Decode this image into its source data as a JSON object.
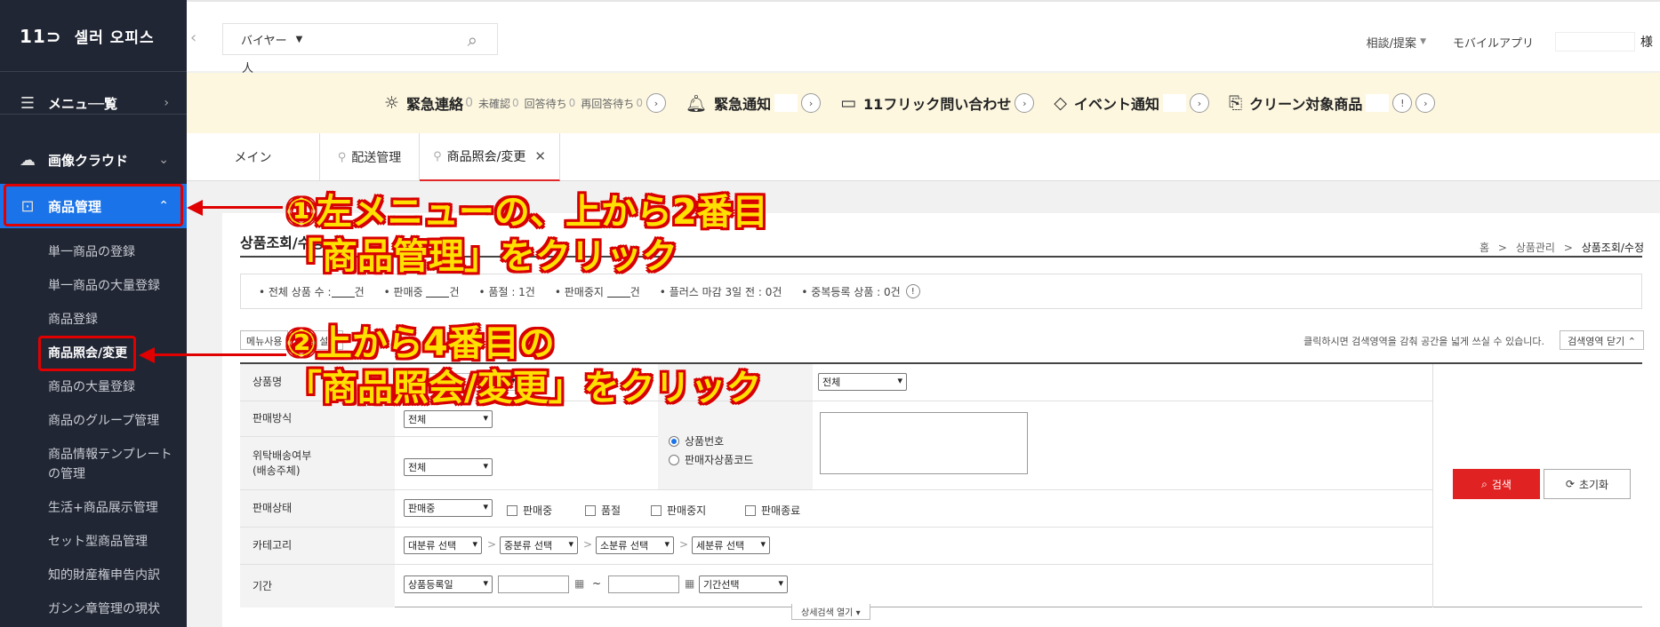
{
  "sidebar": {
    "logo_mark": "11⊃",
    "logo_text": "셀러 오피스",
    "menu_all": "メニュ──覧",
    "image_cloud": "画像クラウド",
    "product_mgmt": "商品管理",
    "sub_items": [
      "単一商品の登録",
      "単一商品の大量登録",
      "商品登録",
      "商品照会/変更",
      "商品の大量登録",
      "商品のグループ管理",
      "商品情報テンプレート",
      "の管理",
      "生活+商品展示管理",
      "セット型商品管理",
      "知的財産権申告内訳",
      "ガンン章管理の現状"
    ]
  },
  "topbar": {
    "buyer_select": "バイヤー",
    "buyer_wrap": "人",
    "consult": "相談/提案",
    "mobile_app": "モバイルアプリ",
    "honorific": "様"
  },
  "notice": {
    "urgent_contact": "緊急連絡",
    "urgent_count": "0",
    "unconfirmed": "未確認",
    "unconfirmed_count": "0",
    "waiting": "回答待ち",
    "waiting_count": "0",
    "re_waiting": "再回答待ち",
    "re_waiting_count": "0",
    "urgent_notice": "緊急通知",
    "flick_inquiry": "11フリック問い合わせ",
    "event_notice": "イベント通知",
    "clean_items": "クリーン対象商品"
  },
  "tabs": {
    "main": "メイン",
    "delivery": "配送管理",
    "product_query": "商品照会/変更"
  },
  "content": {
    "page_title": "상품조회/수정",
    "breadcrumb_home": "홈",
    "breadcrumb_mid": "상품관리",
    "breadcrumb_current": "상품조회/수정",
    "stats": {
      "total": "• 전체 상품 수 :",
      "selling": "• 판매중",
      "soldout": "• 품절 : 1건",
      "stopped": "• 판매중지",
      "deadline": "• 플러스 마감 3일 전 : 0건",
      "duplicate": "• 중복등록 상품 : 0건",
      "unit": "건"
    },
    "btn_menu_use": "메뉴사용",
    "btn_extra": "조회 설정",
    "hint": "클릭하시면 검색영역을 감춰 공간을 넓게 쓰실 수 있습니다.",
    "close_area": "검색영역 닫기",
    "labels": {
      "product_name": "상품명",
      "sale_method": "판매방식",
      "consign": "위탁배송여부",
      "consign_sub": "(배송주체)",
      "sale_status": "판매상태",
      "category": "카테고리",
      "period": "기간"
    },
    "sel_all": "전체",
    "sel_selling": "판매중",
    "radio_product_no": "상품번호",
    "radio_seller_code": "판매자상품코드",
    "chk_selling": "판매중",
    "chk_soldout": "품절",
    "chk_stopped": "판매중지",
    "chk_ended": "판매종료",
    "cat_large": "대분류 선택",
    "cat_mid": "중분류 선택",
    "cat_small": "소분류 선택",
    "cat_detail": "세분류 선택",
    "period_type": "상품등록일",
    "period_select": "기간선택",
    "tilde": "~",
    "btn_search": "검색",
    "btn_reset": "초기화",
    "detail_toggle": "상세검색 열기"
  },
  "annotations": {
    "step1_line1": "①左メニューの、上から2番目",
    "step1_line2": "「商品管理」をクリック",
    "step2_line1": "②上から4番目の",
    "step2_line2": "「商品照会/変更」をクリック"
  },
  "colors": {
    "sidebar_bg": "#212634",
    "active_blue": "#1a73e8",
    "notice_bg": "#fdf7e0",
    "annotation_red": "#e00000",
    "annotation_yellow": "#ffe000",
    "search_red": "#e02222"
  }
}
